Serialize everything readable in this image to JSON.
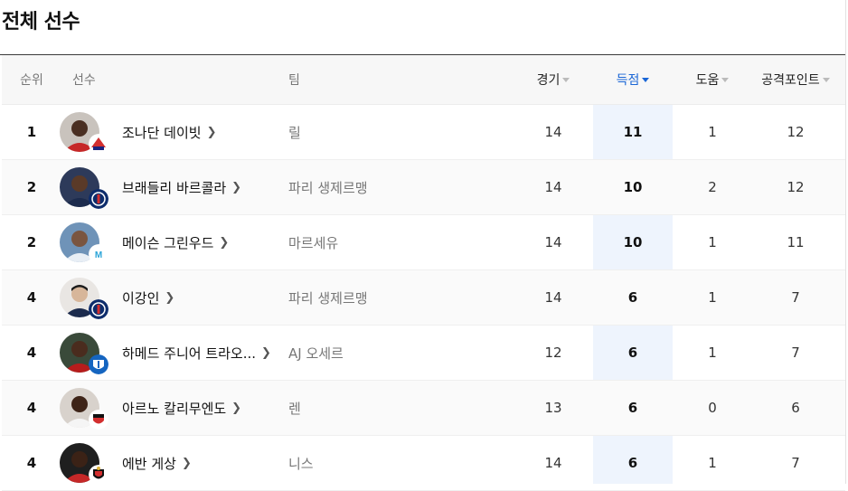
{
  "title": "전체 선수",
  "headers": {
    "rank": "순위",
    "player": "선수",
    "team": "팀",
    "games": "경기",
    "goals": "득점",
    "assists": "도움",
    "points": "공격포인트"
  },
  "sort": {
    "active_column": "goals",
    "direction": "desc"
  },
  "colors": {
    "accent": "#1a66d6",
    "highlight": "#eef4fd"
  },
  "players": [
    {
      "rank": "1",
      "name": "조나단 데이빗",
      "team": "릴",
      "games": "14",
      "goals": "11",
      "assists": "1",
      "points": "12",
      "club_icon": "lille-crest-icon"
    },
    {
      "rank": "2",
      "name": "브래들리 바르콜라",
      "team": "파리 생제르맹",
      "games": "14",
      "goals": "10",
      "assists": "2",
      "points": "12",
      "club_icon": "psg-crest-icon"
    },
    {
      "rank": "2",
      "name": "메이슨 그린우드",
      "team": "마르세유",
      "games": "14",
      "goals": "10",
      "assists": "1",
      "points": "11",
      "club_icon": "marseille-crest-icon"
    },
    {
      "rank": "4",
      "name": "이강인",
      "team": "파리 생제르맹",
      "games": "14",
      "goals": "6",
      "assists": "1",
      "points": "7",
      "club_icon": "psg-crest-icon"
    },
    {
      "rank": "4",
      "name": "하메드 주니어 트라오...",
      "team": "AJ 오세르",
      "games": "12",
      "goals": "6",
      "assists": "1",
      "points": "7",
      "club_icon": "auxerre-crest-icon"
    },
    {
      "rank": "4",
      "name": "아르노 칼리무엔도",
      "team": "렌",
      "games": "13",
      "goals": "6",
      "assists": "0",
      "points": "6",
      "club_icon": "rennes-crest-icon"
    },
    {
      "rank": "4",
      "name": "에반 게상",
      "team": "니스",
      "games": "14",
      "goals": "6",
      "assists": "1",
      "points": "7",
      "club_icon": "nice-crest-icon"
    }
  ]
}
